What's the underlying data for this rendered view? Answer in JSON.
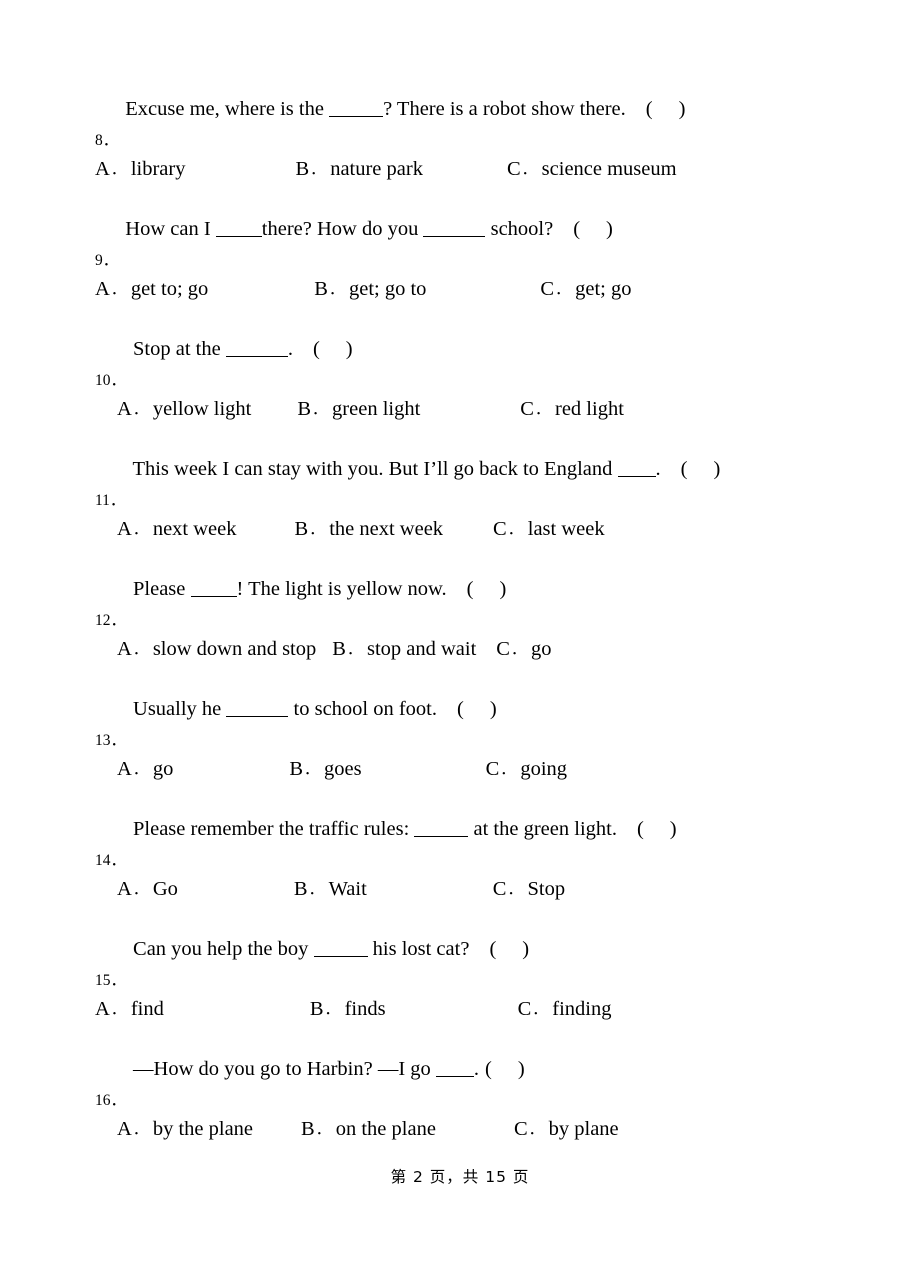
{
  "document": {
    "type": "exam-worksheet",
    "language": "en-zh",
    "page_number": 2,
    "total_pages": 15,
    "footer_text": "第 2 页，共 15 页"
  },
  "questions": [
    {
      "number": "8．",
      "options_indented": false,
      "parts": [
        {
          "t": "text",
          "v": "Excuse me, where is the "
        },
        {
          "t": "blank",
          "size": "b-md"
        },
        {
          "t": "text",
          "v": "? There is a robot show there."
        },
        {
          "t": "paren"
        }
      ],
      "plain": "Excuse me, where is the ______? There is a robot show there. (   )",
      "options": [
        {
          "label": "A",
          "value": "library",
          "pad": 0
        },
        {
          "label": "B",
          "value": "nature park",
          "pad": 110
        },
        {
          "label": "C",
          "value": "science museum",
          "pad": 84
        }
      ]
    },
    {
      "number": "9．",
      "options_indented": false,
      "parts": [
        {
          "t": "text",
          "v": "How can I "
        },
        {
          "t": "blank",
          "size": "b-sm"
        },
        {
          "t": "text",
          "v": "there? How do you "
        },
        {
          "t": "blank",
          "size": "b-lg"
        },
        {
          "t": "text",
          "v": " school?"
        },
        {
          "t": "paren"
        }
      ],
      "plain": "How can I ______there? How do you ________ school? (   )",
      "options": [
        {
          "label": "A",
          "value": "get to; go",
          "pad": 0
        },
        {
          "label": "B",
          "value": "get; go to",
          "pad": 106
        },
        {
          "label": "C",
          "value": "get; go",
          "pad": 114
        }
      ]
    },
    {
      "number": "10．",
      "options_indented": true,
      "parts": [
        {
          "t": "text",
          "v": "Stop at the "
        },
        {
          "t": "blank",
          "size": "b-lg"
        },
        {
          "t": "text",
          "v": "."
        },
        {
          "t": "paren"
        }
      ],
      "plain": "Stop at the _______. (   )",
      "options": [
        {
          "label": "A",
          "value": "yellow light",
          "pad": 0
        },
        {
          "label": "B",
          "value": "green light",
          "pad": 46
        },
        {
          "label": "C",
          "value": "red light",
          "pad": 100
        }
      ]
    },
    {
      "number": "11．",
      "options_indented": true,
      "parts": [
        {
          "t": "text",
          "v": "This week I can stay with you. But I’ll go back to England "
        },
        {
          "t": "blank",
          "size": "b-xs"
        },
        {
          "t": "text",
          "v": "."
        },
        {
          "t": "paren"
        }
      ],
      "plain": "This week I can stay with you. But I’ll go back to England ____. (   )",
      "options": [
        {
          "label": "A",
          "value": "next week",
          "pad": 0
        },
        {
          "label": "B",
          "value": "the next week",
          "pad": 58
        },
        {
          "label": "C",
          "value": "last week",
          "pad": 50
        }
      ]
    },
    {
      "number": "12．",
      "options_indented": true,
      "parts": [
        {
          "t": "text",
          "v": "Please "
        },
        {
          "t": "blank",
          "size": "b-sm"
        },
        {
          "t": "text",
          "v": "! The light is yellow now."
        },
        {
          "t": "paren"
        }
      ],
      "plain": "Please _____! The light is yellow now. (   )",
      "options": [
        {
          "label": "A",
          "value": "slow down and stop",
          "pad": 0
        },
        {
          "label": "B",
          "value": "stop and wait",
          "pad": 16
        },
        {
          "label": "C",
          "value": "go",
          "pad": 20
        }
      ]
    },
    {
      "number": "13．",
      "options_indented": true,
      "parts": [
        {
          "t": "text",
          "v": "Usually he "
        },
        {
          "t": "blank",
          "size": "b-lg"
        },
        {
          "t": "text",
          "v": " to school on foot."
        },
        {
          "t": "paren"
        }
      ],
      "plain": "Usually he _______ to school on foot. (   )",
      "options": [
        {
          "label": "A",
          "value": "go",
          "pad": 0
        },
        {
          "label": "B",
          "value": "goes",
          "pad": 116
        },
        {
          "label": "C",
          "value": "going",
          "pad": 124
        }
      ]
    },
    {
      "number": "14．",
      "options_indented": true,
      "parts": [
        {
          "t": "text",
          "v": "Please remember the traffic rules: "
        },
        {
          "t": "blank",
          "size": "b-md"
        },
        {
          "t": "text",
          "v": " at the green light."
        },
        {
          "t": "paren"
        }
      ],
      "plain": "Please remember the traffic rules: ______ at the green light. (   )",
      "options": [
        {
          "label": "A",
          "value": "Go",
          "pad": 0
        },
        {
          "label": "B",
          "value": "Wait",
          "pad": 116
        },
        {
          "label": "C",
          "value": "Stop",
          "pad": 126
        }
      ]
    },
    {
      "number": "15．",
      "options_indented": false,
      "parts": [
        {
          "t": "text",
          "v": "Can you help the boy "
        },
        {
          "t": "blank",
          "size": "b-md"
        },
        {
          "t": "text",
          "v": " his lost cat?"
        },
        {
          "t": "paren"
        }
      ],
      "plain": "Can you help the boy ______ his lost cat? (   )",
      "options": [
        {
          "label": "A",
          "value": "find",
          "pad": 0
        },
        {
          "label": "B",
          "value": "finds",
          "pad": 146
        },
        {
          "label": "C",
          "value": "finding",
          "pad": 132
        }
      ]
    },
    {
      "number": "16．",
      "options_indented": true,
      "parts": [
        {
          "t": "text",
          "v": "—How do you go to Harbin? —I go "
        },
        {
          "t": "blank",
          "size": "b-xs"
        },
        {
          "t": "text",
          "v": ".",
          "tight": true
        },
        {
          "t": "paren",
          "tight": true
        }
      ],
      "plain": "—How do you go to Harbin? —I go _____. (   )",
      "options": [
        {
          "label": "A",
          "value": "by the plane",
          "pad": 0
        },
        {
          "label": "B",
          "value": "on the plane",
          "pad": 48
        },
        {
          "label": "C",
          "value": "by plane",
          "pad": 78
        }
      ]
    }
  ]
}
